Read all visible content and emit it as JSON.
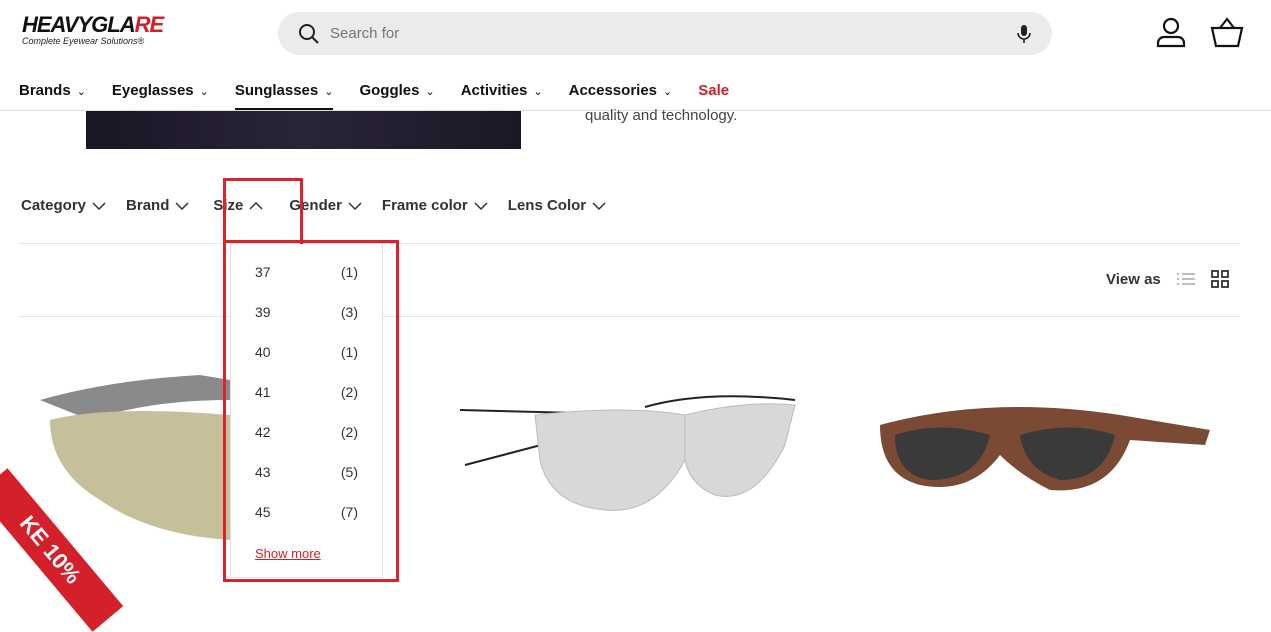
{
  "header": {
    "logo_text": "HEAVYGLARE",
    "logo_sub": "Complete Eyewear Solutions®",
    "search_placeholder": "Search for"
  },
  "nav": [
    {
      "label": "Brands"
    },
    {
      "label": "Eyeglasses"
    },
    {
      "label": "Sunglasses",
      "active": true
    },
    {
      "label": "Goggles"
    },
    {
      "label": "Activities"
    },
    {
      "label": "Accessories"
    },
    {
      "label": "Sale"
    }
  ],
  "hero_text": "quality and technology.",
  "filters": [
    "Category",
    "Brand",
    "Size",
    "Gender",
    "Frame color",
    "Lens Color"
  ],
  "size_options": [
    {
      "size": "37",
      "count": "(1)"
    },
    {
      "size": "39",
      "count": "(3)"
    },
    {
      "size": "40",
      "count": "(1)"
    },
    {
      "size": "41",
      "count": "(2)"
    },
    {
      "size": "42",
      "count": "(2)"
    },
    {
      "size": "43",
      "count": "(5)"
    },
    {
      "size": "45",
      "count": "(7)"
    }
  ],
  "show_more": "Show more",
  "view_as": "View as",
  "promo_ribbon": "KE 10%",
  "colors": {
    "accent": "#d4202a",
    "highlight": "#e0202a"
  }
}
